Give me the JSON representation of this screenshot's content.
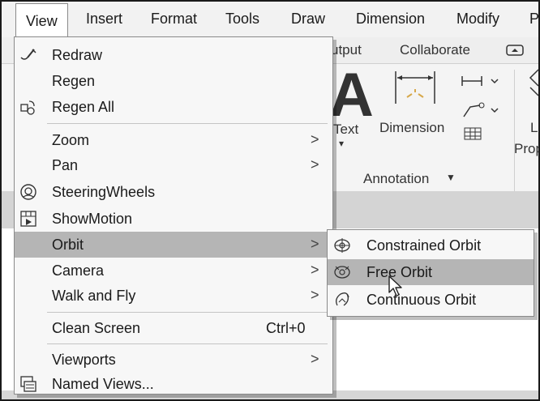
{
  "menubar": {
    "items": [
      "View",
      "Insert",
      "Format",
      "Tools",
      "Draw",
      "Dimension",
      "Modify",
      "P"
    ]
  },
  "ribbon": {
    "tabs": [
      "utput",
      "Collaborate"
    ],
    "text_label": "Text",
    "dimension_label": "Dimension",
    "annotation_label": "Annotation",
    "right_label_1": "La",
    "right_label_2": "Prop"
  },
  "view_menu": {
    "items": [
      {
        "label": "Redraw",
        "icon": "redraw-icon"
      },
      {
        "label": "Regen",
        "icon": ""
      },
      {
        "label": "Regen All",
        "icon": "regen-all-icon"
      },
      {
        "label": "Zoom",
        "submenu": true
      },
      {
        "label": "Pan",
        "submenu": true
      },
      {
        "label": "SteeringWheels",
        "icon": "steering-wheels-icon"
      },
      {
        "label": "ShowMotion",
        "icon": "show-motion-icon"
      },
      {
        "label": "Orbit",
        "submenu": true,
        "highlighted": true
      },
      {
        "label": "Camera",
        "submenu": true
      },
      {
        "label": "Walk and Fly",
        "submenu": true
      },
      {
        "label": "Clean Screen",
        "shortcut": "Ctrl+0"
      },
      {
        "label": "Viewports",
        "submenu": true
      },
      {
        "label": "Named Views...",
        "icon": "named-views-icon"
      }
    ],
    "submenu_arrow": ">"
  },
  "orbit_submenu": {
    "items": [
      {
        "label": "Constrained Orbit",
        "icon": "constrained-orbit-icon"
      },
      {
        "label": "Free Orbit",
        "icon": "free-orbit-icon",
        "highlighted": true
      },
      {
        "label": "Continuous Orbit",
        "icon": "continuous-orbit-icon"
      }
    ]
  },
  "colors": {
    "highlight": "#b5b5b5",
    "menu_bg": "#f7f7f7"
  }
}
